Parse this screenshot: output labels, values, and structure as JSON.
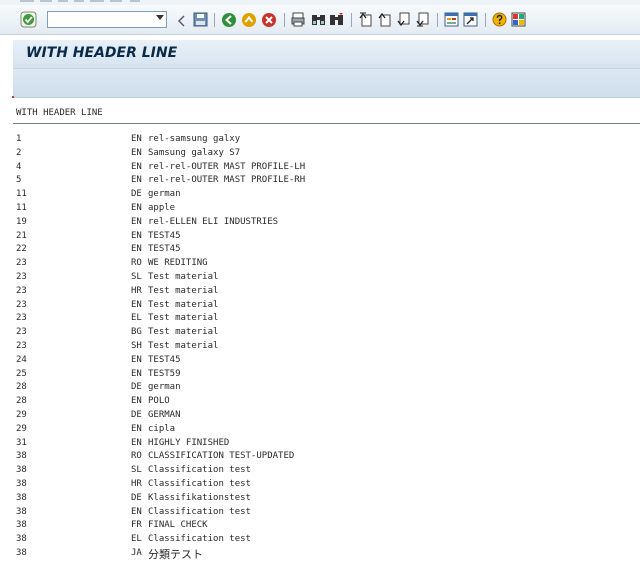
{
  "toolbar": {
    "items": [
      {
        "name": "enter-icon",
        "glyph": "✔",
        "color": "#2e8b2e"
      },
      {
        "name": "back-icon",
        "glyph": "◀"
      },
      {
        "name": "save-icon",
        "glyph": "▪"
      },
      {
        "name": "back-green-icon",
        "glyph": "◀",
        "color": "#2e8b2e"
      },
      {
        "name": "exit-icon",
        "glyph": "▲",
        "color": "#d08a00"
      },
      {
        "name": "cancel-icon",
        "glyph": "✖",
        "color": "#c0392b"
      },
      {
        "name": "print-icon",
        "glyph": "▤"
      },
      {
        "name": "find-icon",
        "glyph": "⌕"
      },
      {
        "name": "find-next-icon",
        "glyph": "⌕"
      },
      {
        "name": "first-page-icon",
        "glyph": "⇞"
      },
      {
        "name": "previous-page-icon",
        "glyph": "↑"
      },
      {
        "name": "next-page-icon",
        "glyph": "↓"
      },
      {
        "name": "last-page-icon",
        "glyph": "⇟"
      },
      {
        "name": "new-session-icon",
        "glyph": "▣"
      },
      {
        "name": "shortcut-icon",
        "glyph": "▨"
      },
      {
        "name": "help-icon",
        "glyph": "?",
        "color": "#d08a00"
      },
      {
        "name": "customize-layout-icon",
        "glyph": "▦"
      }
    ]
  },
  "title": "WITH HEADER LINE",
  "list": {
    "header": "WITH HEADER LINE",
    "rows": [
      {
        "id": "1",
        "lang": "EN",
        "desc": "rel-samsung galxy"
      },
      {
        "id": "2",
        "lang": "EN",
        "desc": "Samsung galaxy S7"
      },
      {
        "id": "4",
        "lang": "EN",
        "desc": "rel-rel-OUTER MAST PROFILE-LH"
      },
      {
        "id": "5",
        "lang": "EN",
        "desc": "rel-rel-OUTER MAST PROFILE-RH"
      },
      {
        "id": "11",
        "lang": "DE",
        "desc": "german"
      },
      {
        "id": "11",
        "lang": "EN",
        "desc": " apple"
      },
      {
        "id": "19",
        "lang": "EN",
        "desc": "rel-ELLEN ELI INDUSTRIES"
      },
      {
        "id": "21",
        "lang": "EN",
        "desc": "TEST45"
      },
      {
        "id": "22",
        "lang": "EN",
        "desc": "TEST45"
      },
      {
        "id": "23",
        "lang": "RO",
        "desc": "WE REDITING"
      },
      {
        "id": "23",
        "lang": "SL",
        "desc": "Test material"
      },
      {
        "id": "23",
        "lang": "HR",
        "desc": "Test material"
      },
      {
        "id": "23",
        "lang": "EN",
        "desc": "Test material"
      },
      {
        "id": "23",
        "lang": "EL",
        "desc": "Test material"
      },
      {
        "id": "23",
        "lang": "BG",
        "desc": "Test material"
      },
      {
        "id": "23",
        "lang": "SH",
        "desc": "Test material"
      },
      {
        "id": "24",
        "lang": "EN",
        "desc": "TEST45"
      },
      {
        "id": "25",
        "lang": "EN",
        "desc": "TEST59"
      },
      {
        "id": "28",
        "lang": "DE",
        "desc": "german"
      },
      {
        "id": "28",
        "lang": "EN",
        "desc": "POLO"
      },
      {
        "id": "29",
        "lang": "DE",
        "desc": "GERMAN"
      },
      {
        "id": "29",
        "lang": "EN",
        "desc": "cipla"
      },
      {
        "id": "31",
        "lang": "EN",
        "desc": "HIGHLY FINISHED"
      },
      {
        "id": "38",
        "lang": "RO",
        "desc": "CLASSIFICATION TEST-UPDATED"
      },
      {
        "id": "38",
        "lang": "SL",
        "desc": "Classification test"
      },
      {
        "id": "38",
        "lang": "HR",
        "desc": "Classification test"
      },
      {
        "id": "38",
        "lang": "DE",
        "desc": "Klassifikationstest"
      },
      {
        "id": "38",
        "lang": "EN",
        "desc": "Classification test"
      },
      {
        "id": "38",
        "lang": "FR",
        "desc": "FINAL CHECK"
      },
      {
        "id": "38",
        "lang": "EL",
        "desc": "Classification test"
      },
      {
        "id": "38",
        "lang": "JA",
        "desc": "分類テスト"
      }
    ]
  }
}
